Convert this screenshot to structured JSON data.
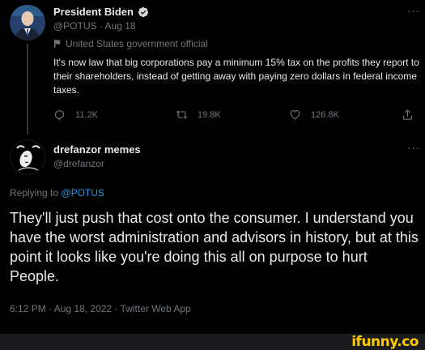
{
  "parent_tweet": {
    "display_name": "President Biden",
    "handle_date": "@POTUS · Aug 18",
    "label": "United States government official",
    "text": "It's now law that big corporations pay a minimum 15% tax on the profits they report to their shareholders, instead of getting away with paying zero dollars in federal income taxes.",
    "more_glyph": "···",
    "replies": "11.2K",
    "retweets": "19.8K",
    "likes": "126.8K"
  },
  "reply_tweet": {
    "display_name": "drefanzor memes",
    "handle": "@drefanzor",
    "more_glyph": "···",
    "replying_prefix": "Replying to",
    "replying_to": "@POTUS",
    "text": "They'll just push that cost onto the consumer. I understand you have the worst administration and advisors in history, but at this point it looks like you're doing this all on purpose to hurt People.",
    "meta": "6:12 PM · Aug 18, 2022 · Twitter Web App"
  },
  "watermark": {
    "text": "ifunny.co",
    "color": "#ffcc00"
  },
  "colors": {
    "background": "#000000",
    "text": "#e7e9ea",
    "muted": "#71767b",
    "link": "#1d9bf0",
    "verified": "#1d9bf0"
  }
}
